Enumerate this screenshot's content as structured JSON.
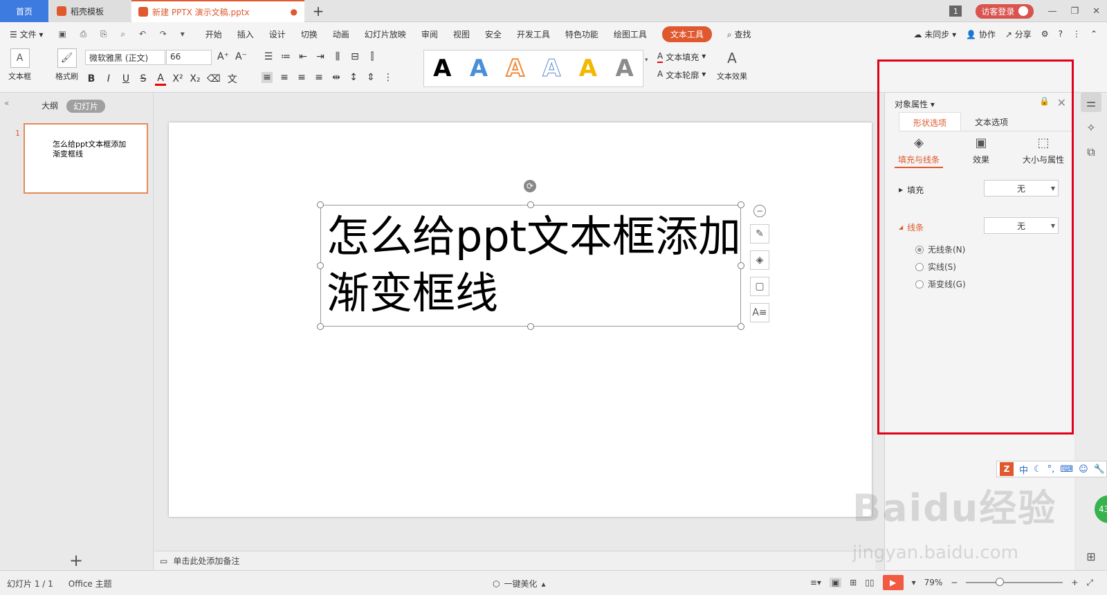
{
  "titlebar": {
    "tab_home": "首页",
    "tab_template": "稻壳模板",
    "tab_doc": "新建 PPTX 演示文稿.pptx",
    "badge": "1",
    "login": "访客登录"
  },
  "menubar": {
    "file": "文件",
    "items": [
      "开始",
      "插入",
      "设计",
      "切换",
      "动画",
      "幻灯片放映",
      "审阅",
      "视图",
      "安全",
      "开发工具",
      "特色功能",
      "绘图工具",
      "文本工具"
    ],
    "search": "查找",
    "right": [
      "未同步",
      "协作",
      "分享"
    ]
  },
  "ribbon": {
    "textbox_label": "文本框",
    "painter_label": "格式刷",
    "font_name": "微软雅黑 (正文)",
    "font_size": "66",
    "text_fill": "文本填充",
    "text_outline": "文本轮廓",
    "text_effect": "文本效果",
    "styles": [
      {
        "char": "A",
        "color": "#000000"
      },
      {
        "char": "A",
        "color": "#4a90d9"
      },
      {
        "char": "A",
        "color": "#f08a3a"
      },
      {
        "char": "A",
        "color": "#5b8bd0"
      },
      {
        "char": "A",
        "color": "#f3b800"
      },
      {
        "char": "A",
        "color": "#8c8c8c"
      }
    ]
  },
  "leftpane": {
    "tab_outline": "大纲",
    "tab_slides": "幻灯片",
    "slide_number": "1",
    "thumb_text": "怎么给ppt文本框添加渐变框线"
  },
  "slide": {
    "text": "怎么给ppt文本框添加渐变框线"
  },
  "notes": {
    "placeholder": "单击此处添加备注"
  },
  "propanel": {
    "title": "对象属性",
    "tab_shape": "形状选项",
    "tab_text": "文本选项",
    "sub_fill_line": "填充与线条",
    "sub_effect": "效果",
    "sub_size": "大小与属性",
    "fill_label": "填充",
    "fill_value": "无",
    "line_label": "线条",
    "line_value": "无",
    "radios": [
      "无线条(N)",
      "实线(S)",
      "渐变线(G)"
    ],
    "radio_checked_index": 0
  },
  "ime": {
    "text": "中"
  },
  "statusbar": {
    "slide_info": "幻灯片 1 / 1",
    "theme": "Office 主题",
    "beautify": "一键美化",
    "zoom": "79%",
    "zoom_level_fraction": 0.35
  },
  "watermark": {
    "brand": "Baidu经验",
    "url": "jingyan.baidu.com"
  },
  "colors": {
    "accent": "#e0582d",
    "home_tab": "#3d7be0",
    "highlight_box": "#e0001b"
  }
}
